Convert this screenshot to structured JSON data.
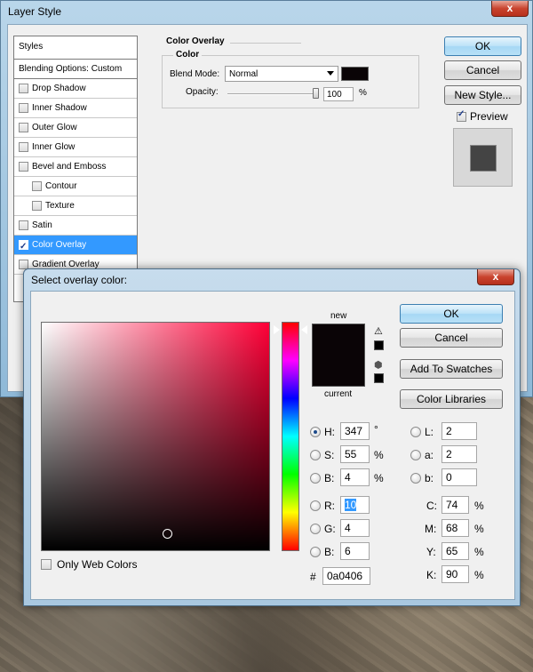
{
  "layer_style": {
    "title": "Layer Style",
    "close_glyph": "x",
    "styles_header": "Styles",
    "blending_options": "Blending Options: Custom",
    "items": [
      {
        "label": "Drop Shadow",
        "checked": false,
        "sub": false,
        "selected": false
      },
      {
        "label": "Inner Shadow",
        "checked": false,
        "sub": false,
        "selected": false
      },
      {
        "label": "Outer Glow",
        "checked": false,
        "sub": false,
        "selected": false
      },
      {
        "label": "Inner Glow",
        "checked": false,
        "sub": false,
        "selected": false
      },
      {
        "label": "Bevel and Emboss",
        "checked": false,
        "sub": false,
        "selected": false
      },
      {
        "label": "Contour",
        "checked": false,
        "sub": true,
        "selected": false
      },
      {
        "label": "Texture",
        "checked": false,
        "sub": true,
        "selected": false
      },
      {
        "label": "Satin",
        "checked": false,
        "sub": false,
        "selected": false
      },
      {
        "label": "Color Overlay",
        "checked": true,
        "sub": false,
        "selected": true
      },
      {
        "label": "Gradient Overlay",
        "checked": false,
        "sub": false,
        "selected": false
      }
    ],
    "section_title": "Color Overlay",
    "group_title": "Color",
    "blend_mode_label": "Blend Mode:",
    "blend_mode_value": "Normal",
    "overlay_swatch_color": "#0a0406",
    "opacity_label": "Opacity:",
    "opacity_value": "100",
    "opacity_unit": "%",
    "opacity_fraction": 1.0,
    "ok_label": "OK",
    "cancel_label": "Cancel",
    "new_style_label": "New Style...",
    "preview_label": "Preview",
    "preview_checked": true
  },
  "color_picker": {
    "title": "Select overlay color:",
    "close_glyph": "x",
    "new_label": "new",
    "current_label": "current",
    "new_color": "#0a0406",
    "current_color": "#0a0406",
    "ok_label": "OK",
    "cancel_label": "Cancel",
    "add_to_swatches_label": "Add To Swatches",
    "color_libraries_label": "Color Libraries",
    "only_web_colors_label": "Only Web Colors",
    "only_web_colors_checked": false,
    "hue_degrees": 347,
    "saturation_percent": 55,
    "brightness_percent": 4,
    "fields": {
      "H": {
        "label": "H:",
        "value": "347",
        "unit": "°"
      },
      "S": {
        "label": "S:",
        "value": "55",
        "unit": "%"
      },
      "B": {
        "label": "B:",
        "value": "4",
        "unit": "%"
      },
      "R": {
        "label": "R:",
        "value": "10",
        "unit": ""
      },
      "G": {
        "label": "G:",
        "value": "4",
        "unit": ""
      },
      "Bb": {
        "label": "B:",
        "value": "6",
        "unit": ""
      },
      "L": {
        "label": "L:",
        "value": "2",
        "unit": ""
      },
      "a": {
        "label": "a:",
        "value": "2",
        "unit": ""
      },
      "b": {
        "label": "b:",
        "value": "0",
        "unit": ""
      },
      "C": {
        "label": "C:",
        "value": "74",
        "unit": "%"
      },
      "M": {
        "label": "M:",
        "value": "68",
        "unit": "%"
      },
      "Y": {
        "label": "Y:",
        "value": "65",
        "unit": "%"
      },
      "K": {
        "label": "K:",
        "value": "90",
        "unit": "%"
      }
    },
    "hex_label": "#",
    "hex_value": "0a0406",
    "warning_glyph": "⚠",
    "cube_glyph": "⬢",
    "gamut_swatch_color": "#000000",
    "web_swatch_color": "#000000"
  }
}
